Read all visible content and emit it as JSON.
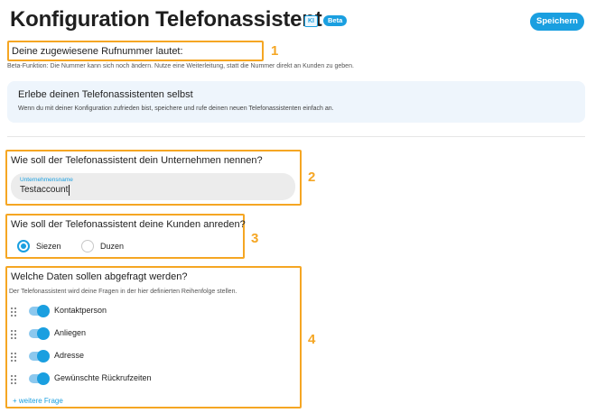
{
  "header": {
    "title": "Konfiguration Telefonassistent",
    "badge_ki": "KI",
    "badge_beta": "Beta",
    "save_label": "Speichern"
  },
  "section_number": {
    "heading": "Deine zugewiesene Rufnummer lautet:",
    "caption": "Beta-Funktion: Die Nummer kann sich noch ändern. Nutze eine Weiterleitung, statt die Nummer direkt an Kunden zu geben."
  },
  "info_box": {
    "title": "Erlebe deinen Telefonassistenten selbst",
    "text": "Wenn du mit deiner Konfiguration zufrieden bist, speichere und rufe deinen neuen Telefonassistenten einfach an."
  },
  "section_company": {
    "heading": "Wie soll der Telefonassistent dein Unternehmen nennen?",
    "input_label": "Unternehmensname",
    "input_value": "Testaccount"
  },
  "section_address": {
    "heading": "Wie soll der Telefonassistent deine Kunden anreden?",
    "options": [
      {
        "label": "Siezen",
        "selected": true
      },
      {
        "label": "Duzen",
        "selected": false
      }
    ]
  },
  "section_fields": {
    "heading": "Welche Daten sollen abgefragt werden?",
    "caption": "Der Telefonassistent wird deine Fragen in der hier definierten Reihenfolge stellen.",
    "items": [
      {
        "label": "Kontaktperson",
        "enabled": true
      },
      {
        "label": "Anliegen",
        "enabled": true
      },
      {
        "label": "Adresse",
        "enabled": true
      },
      {
        "label": "Gewünschte Rückrufzeiten",
        "enabled": true
      }
    ],
    "add_label": "+ weitere Frage"
  },
  "annotations": [
    "1",
    "2",
    "3",
    "4"
  ],
  "colors": {
    "accent": "#1a9fe0",
    "highlight": "#f5a623",
    "info_bg": "#eef5fc"
  }
}
